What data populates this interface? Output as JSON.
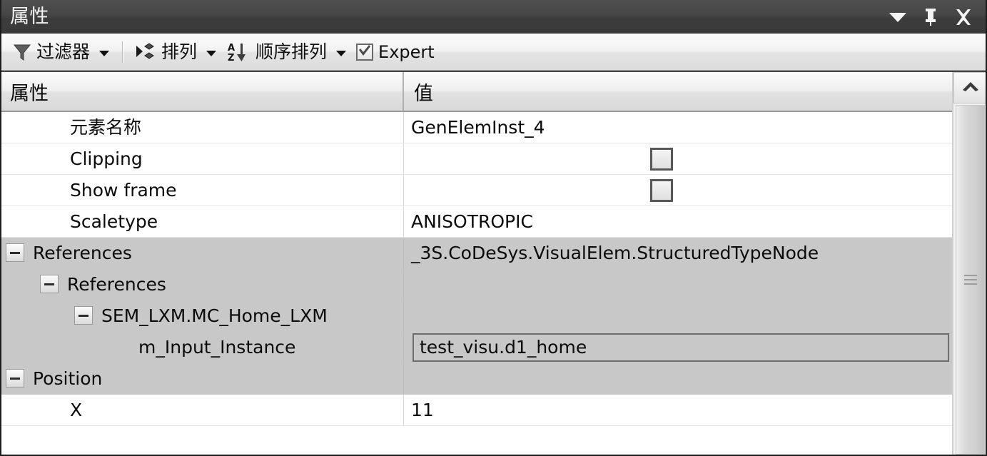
{
  "window": {
    "title": "属性",
    "controls": [
      {
        "name": "dropdown-menu-button",
        "icon": "chevron-down-icon"
      },
      {
        "name": "pin-button",
        "icon": "pin-icon"
      },
      {
        "name": "close-button",
        "icon": "close-icon"
      }
    ]
  },
  "toolbar": {
    "filter_label": "过滤器",
    "arrange_label": "排列",
    "sort_label": "顺序排列",
    "expert_label": "Expert",
    "expert_checked": true,
    "icons": {
      "filter": "funnel-icon",
      "arrange": "group-arrange-icon",
      "sort": "sort-az-icon"
    }
  },
  "grid": {
    "columns": [
      {
        "key": "name",
        "label": "属性"
      },
      {
        "key": "value",
        "label": "值"
      }
    ],
    "rows": [
      {
        "name": "元素名称",
        "indent": 1,
        "expander": null,
        "shaded": false,
        "value_type": "text",
        "value": "GenElemInst_4"
      },
      {
        "name": "Clipping",
        "indent": 1,
        "expander": null,
        "shaded": false,
        "value_type": "checkbox",
        "value": "",
        "checked": false
      },
      {
        "name": "Show frame",
        "indent": 1,
        "expander": null,
        "shaded": false,
        "value_type": "checkbox",
        "value": "",
        "checked": false
      },
      {
        "name": "Scaletype",
        "indent": 1,
        "expander": null,
        "shaded": false,
        "value_type": "text",
        "value": "ANISOTROPIC"
      },
      {
        "name": "References",
        "indent": 0,
        "expander": "collapse",
        "shaded": true,
        "value_type": "text",
        "value": "_3S.CoDeSys.VisualElem.StructuredTypeNode"
      },
      {
        "name": "References",
        "indent": 1,
        "expander": "collapse",
        "shaded": true,
        "value_type": "text",
        "value": ""
      },
      {
        "name": "SEM_LXM.MC_Home_LXM",
        "indent": 2,
        "expander": "collapse",
        "shaded": true,
        "value_type": "text",
        "value": ""
      },
      {
        "name": "m_Input_Instance",
        "indent": 3,
        "expander": null,
        "shaded": true,
        "value_type": "editor",
        "value": "test_visu.d1_home"
      },
      {
        "name": "Position",
        "indent": 0,
        "expander": "collapse",
        "shaded": true,
        "value_type": "text",
        "value": ""
      },
      {
        "name": "X",
        "indent": 1,
        "expander": null,
        "shaded": false,
        "value_type": "text",
        "value": "11"
      }
    ]
  },
  "scrollbar": {
    "up_arrow": "chevron-up-icon",
    "thumb_grip": "grip-lines-icon"
  }
}
